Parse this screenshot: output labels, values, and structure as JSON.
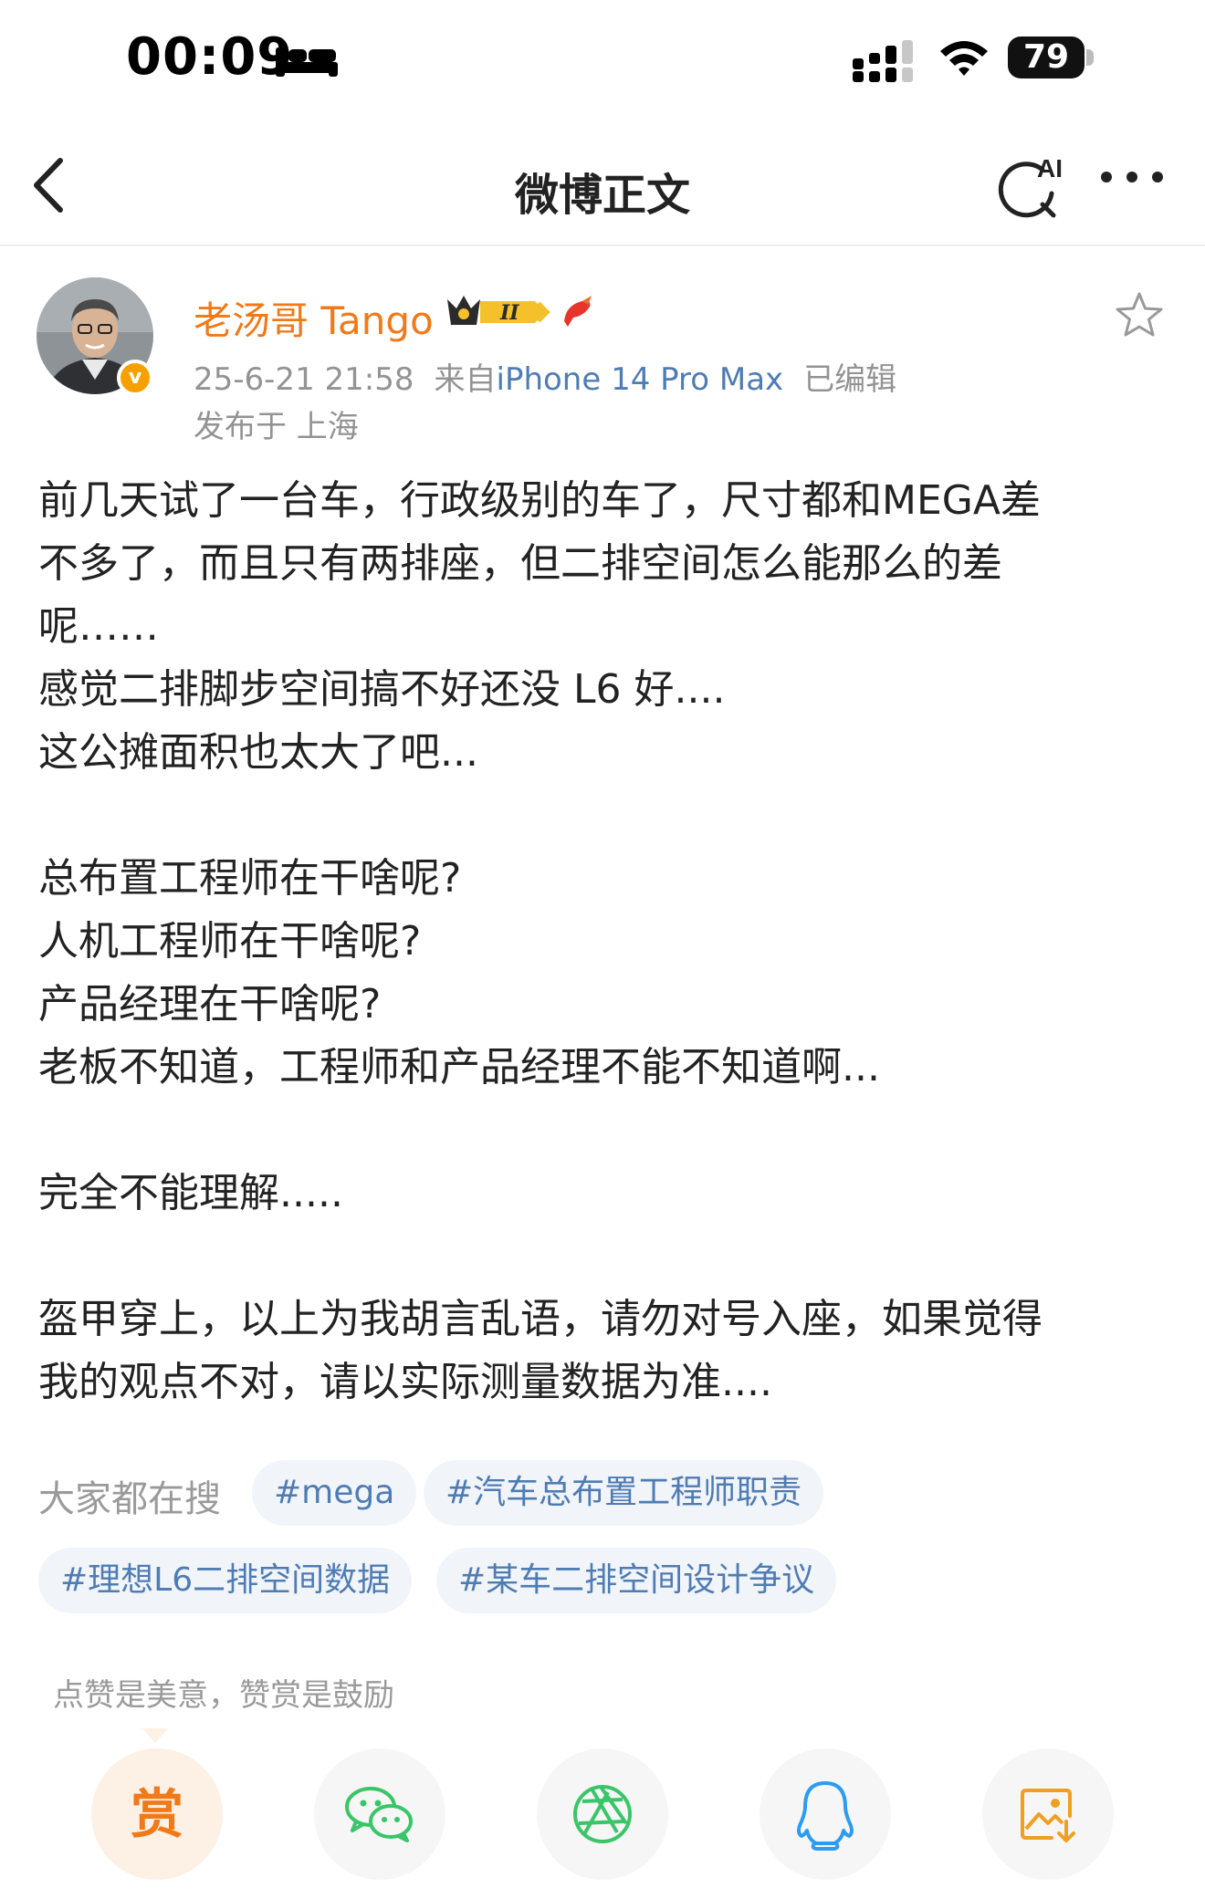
{
  "status_bar": {
    "time": "00:09",
    "battery": "79",
    "icons": [
      "bed-icon",
      "signal-icon",
      "wifi-icon",
      "battery-icon"
    ]
  },
  "nav": {
    "title": "微博正文",
    "ai_label": "AI",
    "icons": [
      "back-icon",
      "ai-search-icon",
      "more-icon"
    ]
  },
  "author": {
    "name": "老汤哥 Tango",
    "vip_level": "II",
    "verified_mark": "v",
    "timestamp": "25-6-21 21:58",
    "source_prefix": "来自",
    "source": "iPhone 14 Pro Max",
    "edited": "已编辑",
    "location": "发布于 上海"
  },
  "post": {
    "lines": [
      "前几天试了一台车，行政级别的车了，尺寸都和MEGA差",
      "不多了，而且只有两排座，但二排空间怎么能那么的差",
      "呢……",
      "感觉二排脚步空间搞不好还没 L6 好....",
      "这公摊面积也太大了吧...",
      "",
      "总布置工程师在干啥呢?",
      "人机工程师在干啥呢?",
      "产品经理在干啥呢?",
      "老板不知道，工程师和产品经理不能不知道啊...",
      "",
      "完全不能理解.....",
      "",
      "盔甲穿上，以上为我胡言乱语，请勿对号入座，如果觉得",
      "我的观点不对，请以实际测量数据为准...."
    ]
  },
  "related_search": {
    "label": "大家都在搜",
    "tags": [
      "#mega",
      "#汽车总布置工程师职责",
      "#理想L6二排空间数据",
      "#某车二排空间设计争议"
    ]
  },
  "reward": {
    "hint": "点赞是美意，赞赏是鼓励",
    "button_label": "赏"
  },
  "share_buttons": [
    "reward-button",
    "wechat-button",
    "moments-button",
    "qq-button",
    "save-image-button"
  ],
  "colors": {
    "author_name": "#f07a1a",
    "link_blue": "#4f7cb3",
    "meta_gray": "#939393",
    "tag_bg": "#f1f5fa",
    "wechat_green": "#3ac569",
    "qq_blue": "#2d9cf0",
    "accent_orange": "#f07a1a"
  }
}
